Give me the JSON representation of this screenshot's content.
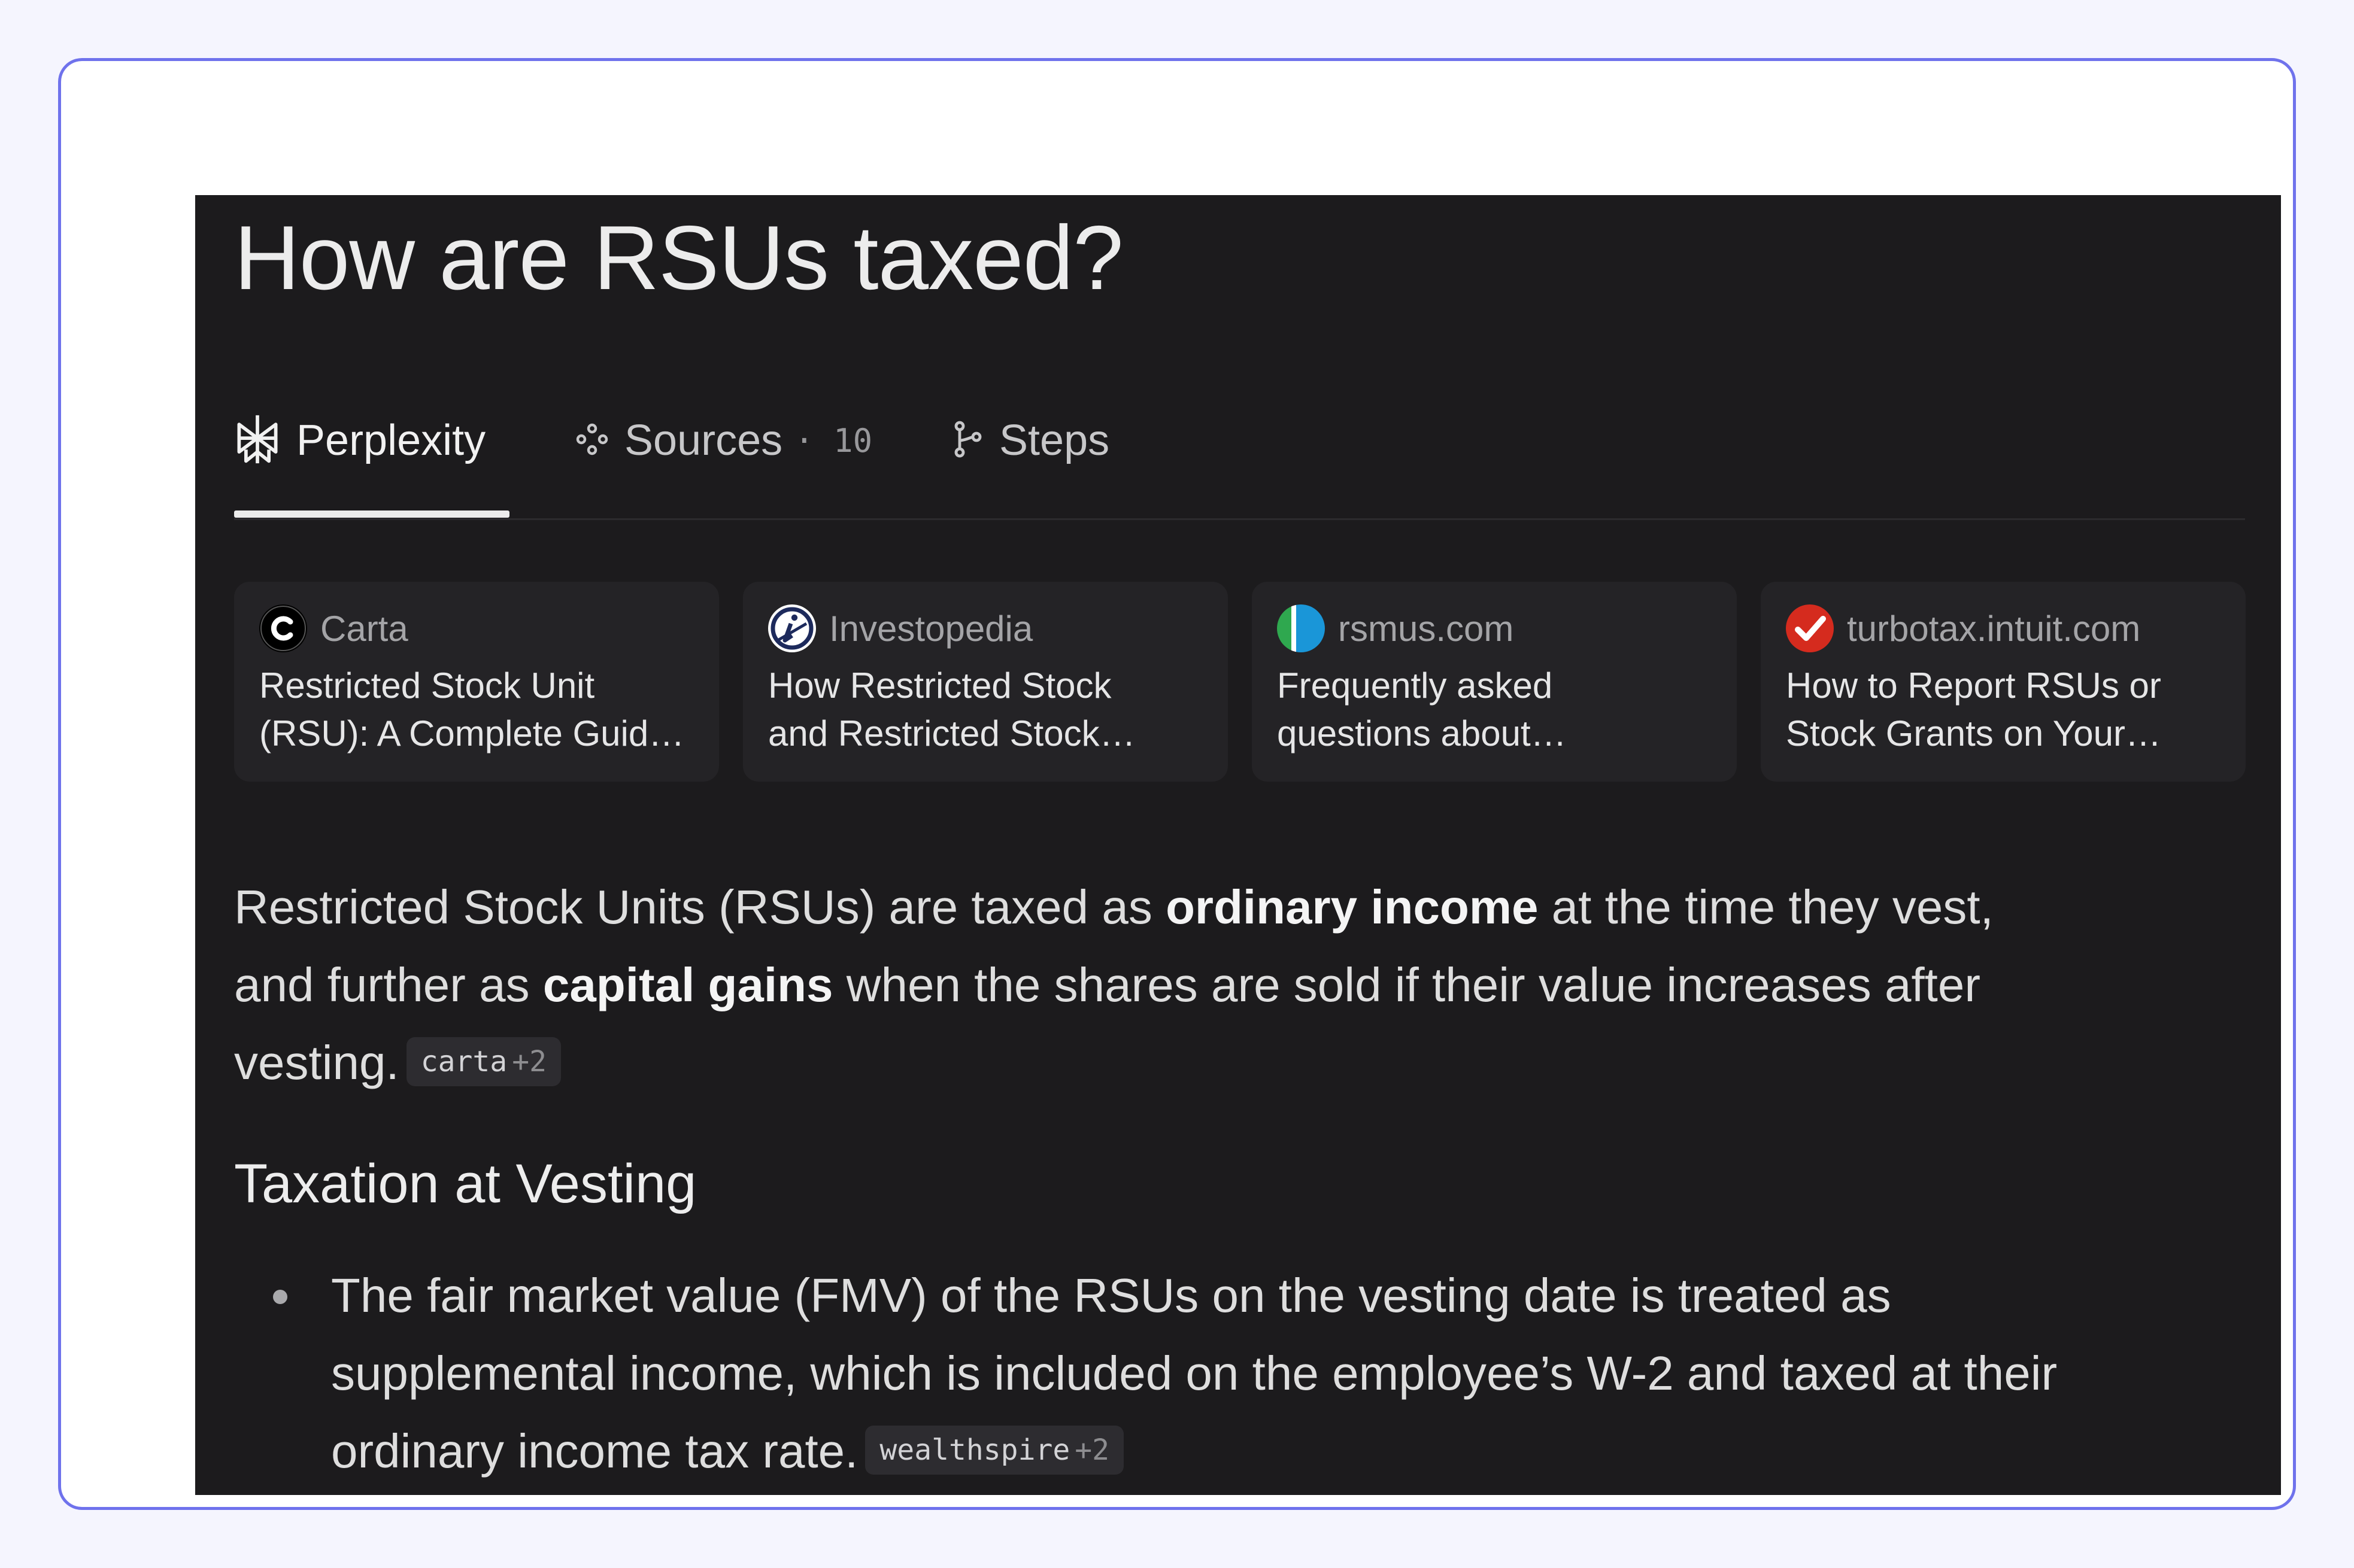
{
  "page": {
    "title": "How are RSUs taxed?"
  },
  "tabs": [
    {
      "label": "Perplexity",
      "icon": "perplexity-logo-icon",
      "active": true
    },
    {
      "label": "Sources",
      "icon": "sources-nodes-icon",
      "count": "· 10",
      "active": false
    },
    {
      "label": "Steps",
      "icon": "steps-branch-icon",
      "active": false
    }
  ],
  "sources": [
    {
      "site": "Carta",
      "title_line1": "Restricted Stock Unit",
      "title_line2": "(RSU): A Complete Guid…",
      "icon": "carta-favicon",
      "color": "#000000"
    },
    {
      "site": "Investopedia",
      "title_line1": "How Restricted Stock",
      "title_line2": "and Restricted Stock…",
      "icon": "investopedia-favicon",
      "color": "#1d2a5c"
    },
    {
      "site": "rsmus.com",
      "title_line1": "Frequently asked",
      "title_line2": "questions about…",
      "icon": "rsmus-favicon",
      "color": "#1a96d8"
    },
    {
      "site": "turbotax.intuit.com",
      "title_line1": "How to Report RSUs or",
      "title_line2": "Stock Grants on Your…",
      "icon": "turbotax-favicon",
      "color": "#d52b1e"
    }
  ],
  "answer": {
    "p1_a": "Restricted Stock Units (RSUs) are taxed as ",
    "p1_b": "ordinary income",
    "p1_c": " at the time they vest,",
    "p2_a": "and further as ",
    "p2_b": "capital gains",
    "p2_c": " when the shares are sold if their value increases after",
    "p3_a": "vesting.",
    "cite1_name": "carta",
    "cite1_plus": "+2",
    "heading": "Taxation at Vesting",
    "bullet1_l1": "The fair market value (FMV) of the RSUs on the vesting date is treated as",
    "bullet1_l2": "supplemental income, which is included on the employee’s W-2 and taxed at their",
    "bullet1_l3": "ordinary income tax rate.",
    "cite2_name": "wealthspire",
    "cite2_plus": "+2"
  },
  "colors": {
    "background": "#f5f5fe",
    "frame_border": "#6f72ec",
    "panel": "#1c1b1d",
    "card": "#242326"
  }
}
